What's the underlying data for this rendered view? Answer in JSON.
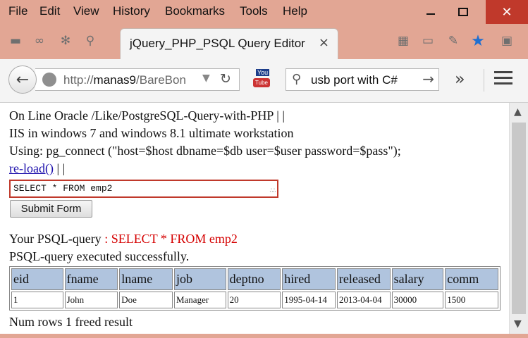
{
  "menu": {
    "file": "File",
    "edit": "Edit",
    "view": "View",
    "history": "History",
    "bookmarks": "Bookmarks",
    "tools": "Tools",
    "help": "Help"
  },
  "tab": {
    "title": "jQuery_PHP_PSQL Query Editor",
    "close": "×"
  },
  "nav": {
    "url_prefix": "http://",
    "url_host": "manas9",
    "url_path": "/BareBon",
    "search_value": "usb port with C#",
    "yt_top": "You",
    "yt_bottom": "Tube"
  },
  "content": {
    "line1": "On Line Oracle /Like/PostgreSQL-Query-with-PHP | |",
    "line2": "IIS in windows 7 and windows 8.1 ultimate workstation",
    "line3": "Using: pg_connect (\"host=$host dbname=$db user=$user password=$pass\");",
    "reload_link": "re-load()",
    "reload_suffix": " | |",
    "query_value": "SELECT * FROM emp2",
    "submit_label": "Submit Form",
    "your_query_label": "Your PSQL-query",
    "your_query_value": " : SELECT * FROM emp2",
    "executed": "PSQL-query executed successfully.",
    "footer": "Num rows 1 freed result"
  },
  "table": {
    "headers": [
      "eid",
      "fname",
      "lname",
      "job",
      "deptno",
      "hired",
      "released",
      "salary",
      "comm"
    ],
    "rows": [
      [
        "1",
        "John",
        "Doe",
        "Manager",
        "20",
        "1995-04-14",
        "2013-04-04",
        "30000",
        "1500"
      ]
    ]
  },
  "colors": {
    "frame": "#e2a694",
    "header_bg": "#b0c4de",
    "query_border": "#c0392b",
    "red_text": "#d50000",
    "link": "#1a0dab"
  }
}
